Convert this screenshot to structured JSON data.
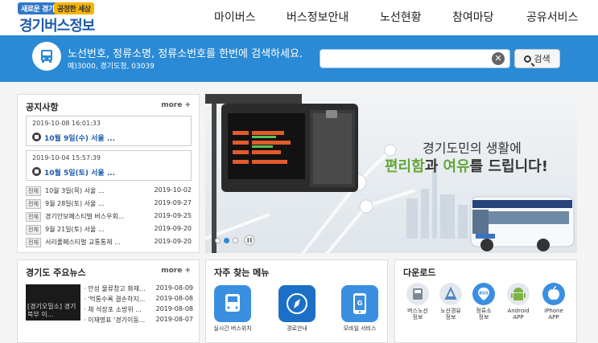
{
  "logo": {
    "tag1": "새로운 경기",
    "tag2": "공정한 세상",
    "name": "경기버스정보"
  },
  "nav": [
    "마이버스",
    "버스정보안내",
    "노선현황",
    "참여마당",
    "공유서비스"
  ],
  "search": {
    "title": "노선번호, 정류소명, 정류소번호를 한번에 검색하세요.",
    "example": "예)3000, 경기도청, 03039",
    "value": "",
    "button_label": "검색"
  },
  "notice": {
    "title": "공지사항",
    "more": "more +",
    "cards": [
      {
        "timestamp": "2019-10-08 16:01:33",
        "text": "10월 9일(수) 서울 ..."
      },
      {
        "timestamp": "2019-10-04 15:57:39",
        "text": "10월 5일(토) 서울 ..."
      }
    ],
    "rows": [
      {
        "badge": "전체",
        "text": "10월 3일(목) 서울 ...",
        "date": "2019-10-02"
      },
      {
        "badge": "전체",
        "text": "9월 28일(토) 서울 ...",
        "date": "2019-09-27"
      },
      {
        "badge": "전체",
        "text": "경기안보페스티벌 버스우회...",
        "date": "2019-09-25"
      },
      {
        "badge": "전체",
        "text": "9월 21일(토) 서울 ...",
        "date": "2019-09-20"
      },
      {
        "badge": "전체",
        "text": "서리풀페스티벌 교통통제 ...",
        "date": "2019-09-20"
      }
    ]
  },
  "banner": {
    "headline": "경기도민의 생활에",
    "tagline_part1": "편리함",
    "tagline_part2": "과 ",
    "tagline_part3": "여유",
    "tagline_part4": "를 드립니다!"
  },
  "news": {
    "title": "경기도 주요뉴스",
    "more": "more +",
    "thumb_caption": "[경기오밀소] 경기북부 이...",
    "rows": [
      {
        "text": "· 안성 물류창고 화재...",
        "date": "2019-08-09"
      },
      {
        "text": "· '먹통수록 결손하지...",
        "date": "2019-08-08"
      },
      {
        "text": "· 채 석장포 소방위 ...",
        "date": "2019-08-08"
      },
      {
        "text": "· 이재명표 '경기이동...",
        "date": "2019-08-07"
      }
    ]
  },
  "menu": {
    "title": "자주 찾는 메뉴",
    "items": [
      "실시간 버스위치",
      "경로안내",
      "모바일 서비스"
    ]
  },
  "download": {
    "title": "다운로드",
    "items": [
      {
        "line1": "버스노선",
        "line2": "정보"
      },
      {
        "line1": "노선경유",
        "line2": "정보"
      },
      {
        "line1": "정류소",
        "line2": "정보"
      },
      {
        "line1": "Android",
        "line2": "APP"
      },
      {
        "line1": "iPhone",
        "line2": "APP"
      }
    ]
  },
  "colors": {
    "brand_blue": "#2a8ad5",
    "dark_blue": "#1f5aab",
    "accent_green": "#65a63a"
  }
}
